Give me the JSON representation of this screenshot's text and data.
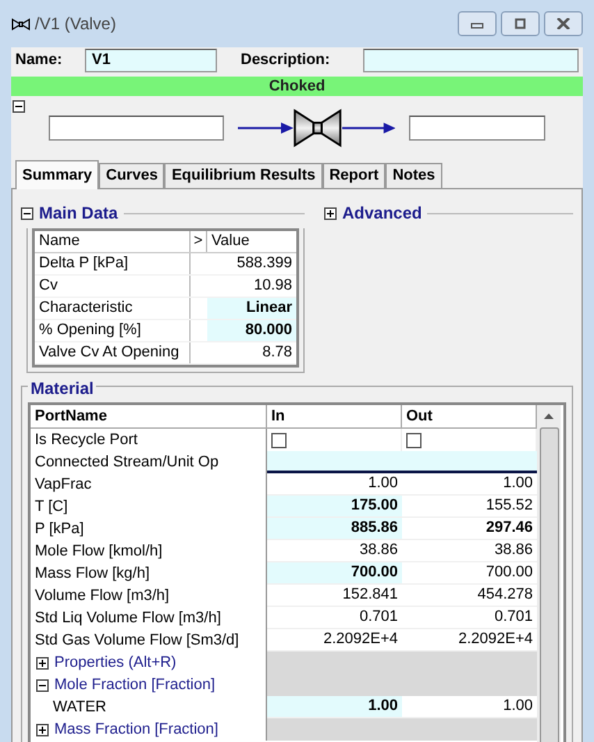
{
  "window": {
    "title": "/V1 (Valve)"
  },
  "name_field": {
    "label": "Name:",
    "value": "V1"
  },
  "description_field": {
    "label": "Description:"
  },
  "status": {
    "text": "Choked"
  },
  "tabs": [
    {
      "label": "Summary",
      "selected": true
    },
    {
      "label": "Curves",
      "selected": false
    },
    {
      "label": "Equilibrium Results",
      "selected": false
    },
    {
      "label": "Report",
      "selected": false
    },
    {
      "label": "Notes",
      "selected": false
    }
  ],
  "main_data": {
    "title": "Main Data",
    "expanded": true,
    "columns": [
      "Name",
      ">",
      "Value"
    ],
    "rows": [
      {
        "name": "Delta P [kPa]",
        "value": "588.399",
        "editable": false
      },
      {
        "name": "Cv",
        "value": "10.98",
        "editable": false
      },
      {
        "name": "Characteristic",
        "value": "Linear",
        "editable": true
      },
      {
        "name": "% Opening [%]",
        "value": "80.000",
        "editable": true
      },
      {
        "name": "Valve Cv At Opening",
        "value": "8.78",
        "editable": false
      }
    ]
  },
  "advanced": {
    "title": "Advanced",
    "expanded": false
  },
  "material": {
    "title": "Material",
    "columns": [
      "PortName",
      "In",
      "Out"
    ],
    "rows": [
      {
        "kind": "checkbox",
        "label": "Is Recycle Port",
        "cells": [
          {
            "checked": false
          },
          {
            "checked": false
          }
        ]
      },
      {
        "kind": "link",
        "label": "Connected Stream/Unit Op"
      },
      {
        "kind": "value",
        "label": "VapFrac",
        "cells": [
          {
            "text": "1.00",
            "editable": false,
            "bold": false
          },
          {
            "text": "1.00",
            "editable": false,
            "bold": false
          }
        ]
      },
      {
        "kind": "value",
        "label": "T [C]",
        "cells": [
          {
            "text": "175.00",
            "editable": true,
            "bold": true
          },
          {
            "text": "155.52",
            "editable": false,
            "bold": false
          }
        ]
      },
      {
        "kind": "value",
        "label": "P [kPa]",
        "cells": [
          {
            "text": "885.86",
            "editable": true,
            "bold": true
          },
          {
            "text": "297.46",
            "editable": false,
            "bold": true
          }
        ]
      },
      {
        "kind": "value",
        "label": "Mole Flow [kmol/h]",
        "cells": [
          {
            "text": "38.86",
            "editable": false,
            "bold": false
          },
          {
            "text": "38.86",
            "editable": false,
            "bold": false
          }
        ]
      },
      {
        "kind": "value",
        "label": "Mass Flow [kg/h]",
        "cells": [
          {
            "text": "700.00",
            "editable": true,
            "bold": true
          },
          {
            "text": "700.00",
            "editable": false,
            "bold": false
          }
        ]
      },
      {
        "kind": "value",
        "label": "Volume Flow [m3/h]",
        "cells": [
          {
            "text": "152.841",
            "editable": false,
            "bold": false
          },
          {
            "text": "454.278",
            "editable": false,
            "bold": false
          }
        ]
      },
      {
        "kind": "value",
        "label": "Std Liq Volume Flow [m3/h]",
        "cells": [
          {
            "text": "0.701",
            "editable": false,
            "bold": false
          },
          {
            "text": "0.701",
            "editable": false,
            "bold": false
          }
        ]
      },
      {
        "kind": "value",
        "label": "Std Gas Volume Flow [Sm3/d]",
        "cells": [
          {
            "text": "2.2092E+4",
            "editable": false,
            "bold": false
          },
          {
            "text": "2.2092E+4",
            "editable": false,
            "bold": false
          }
        ]
      },
      {
        "kind": "section",
        "label": "Properties  (Alt+R)",
        "expanded": false
      },
      {
        "kind": "section",
        "label": "Mole Fraction [Fraction]",
        "expanded": true
      },
      {
        "kind": "component",
        "label": "WATER",
        "cells": [
          {
            "text": "1.00",
            "editable": true,
            "bold": true
          },
          {
            "text": "1.00",
            "editable": false,
            "bold": false
          }
        ]
      },
      {
        "kind": "section",
        "label": "Mass Fraction [Fraction]",
        "expanded": false
      }
    ]
  }
}
